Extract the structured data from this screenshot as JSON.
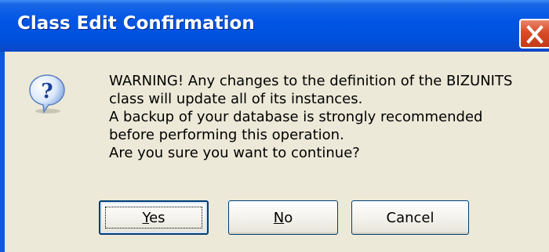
{
  "window": {
    "title": "Class Edit Confirmation",
    "title_bar_color": "#0055e5",
    "body_color": "#ece9d8"
  },
  "icons": {
    "question": "question-icon",
    "close": "close-icon"
  },
  "message": {
    "lines": [
      "WARNING! Any changes to the definition of the BIZUNITS",
      "class will update all of its instances.",
      "A backup of your database is strongly recommended",
      "before performing this operation.",
      "Are you sure you want to continue?"
    ]
  },
  "buttons": {
    "yes": {
      "mnemonic": "Y",
      "rest": "es"
    },
    "no": {
      "mnemonic": "N",
      "rest": "o"
    },
    "cancel": {
      "label": "Cancel"
    }
  },
  "default_button": "yes"
}
